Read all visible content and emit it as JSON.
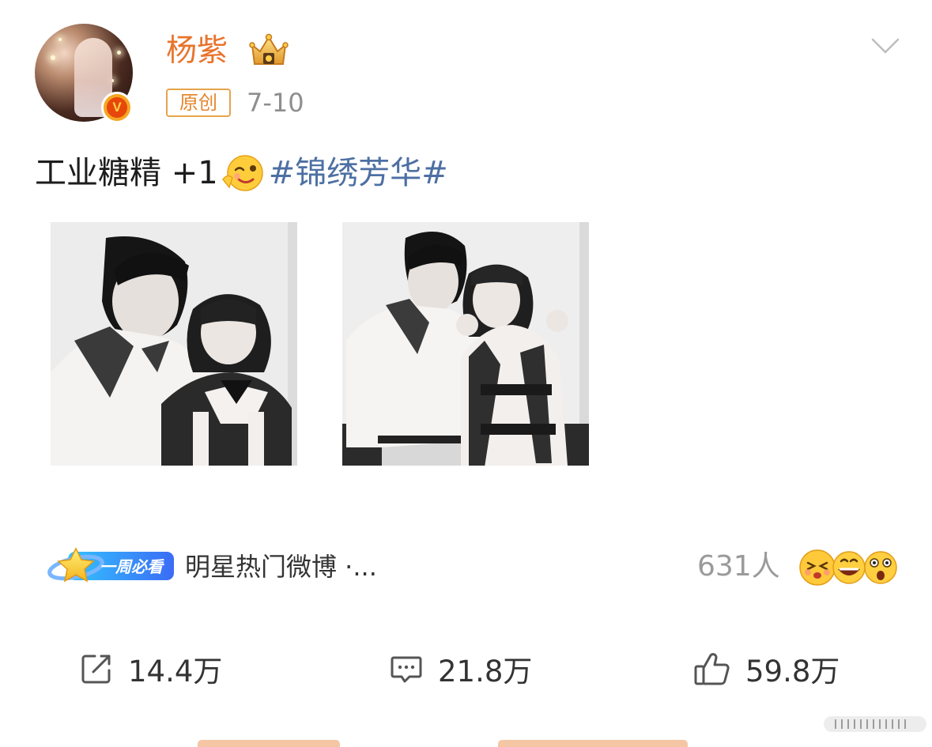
{
  "post": {
    "author": {
      "name": "杨紫",
      "avatar_icon": "avatar-photo",
      "verified_icon": "verified-v-badge",
      "member_icon": "crown-icon"
    },
    "source_tag": "原创",
    "time": "7-10",
    "text": {
      "main": "工业糖精 +1",
      "emoji": "wink-emoji",
      "hashtag": "#锦绣芳华#"
    },
    "images": [
      {
        "name": "photo-1",
        "icon": "black-and-white-photo"
      },
      {
        "name": "photo-2",
        "icon": "black-and-white-photo"
      }
    ]
  },
  "weekly": {
    "badge_text": "一周必看",
    "topic": "明星热门微博 ·...",
    "reaction_count": "631人",
    "reaction_emojis": [
      "kiss-emoji",
      "laugh-emoji",
      "surprised-emoji"
    ]
  },
  "actions": {
    "repost": {
      "icon": "repost-icon",
      "count": "14.4万"
    },
    "comment": {
      "icon": "comment-icon",
      "count": "21.8万"
    },
    "like": {
      "icon": "like-icon",
      "count": "59.8万"
    }
  },
  "colors": {
    "username": "#e8742d",
    "hashtag": "#4d6fa3",
    "source_tag_border": "#e6a44b",
    "muted": "#8e8e8e",
    "weekly_badge": "#3d7bf5"
  }
}
